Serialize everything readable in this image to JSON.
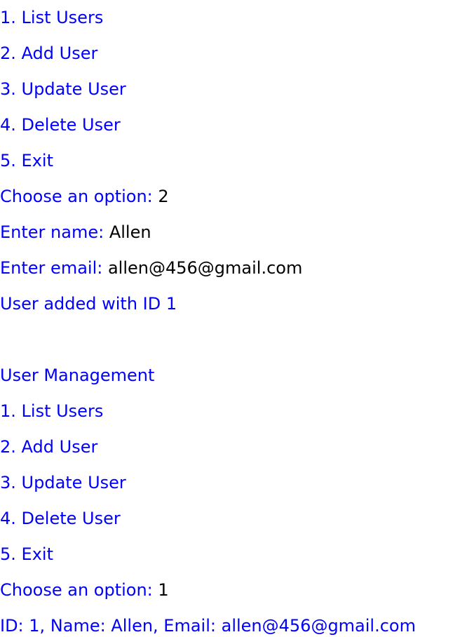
{
  "colors": {
    "prompt": "#0000ff",
    "input": "#000000",
    "background": "#ffffff"
  },
  "session": {
    "menu1": {
      "item1": "1. List Users",
      "item2": "2. Add User",
      "item3": "3. Update User",
      "item4": "4. Delete User",
      "item5": "5. Exit",
      "choose_prompt": "Choose an option: ",
      "choose_value": "2"
    },
    "add_user": {
      "name_prompt": "Enter name: ",
      "name_value": "Allen",
      "email_prompt": "Enter email: ",
      "email_value": "allen@456@gmail.com",
      "result": "User added with ID 1"
    },
    "menu2": {
      "title": "User Management",
      "item1": "1. List Users",
      "item2": "2. Add User",
      "item3": "3. Update User",
      "item4": "4. Delete User",
      "item5": "5. Exit",
      "choose_prompt": "Choose an option: ",
      "choose_value": "1"
    },
    "list_result": "ID: 1, Name: Allen, Email: allen@456@gmail.com"
  }
}
